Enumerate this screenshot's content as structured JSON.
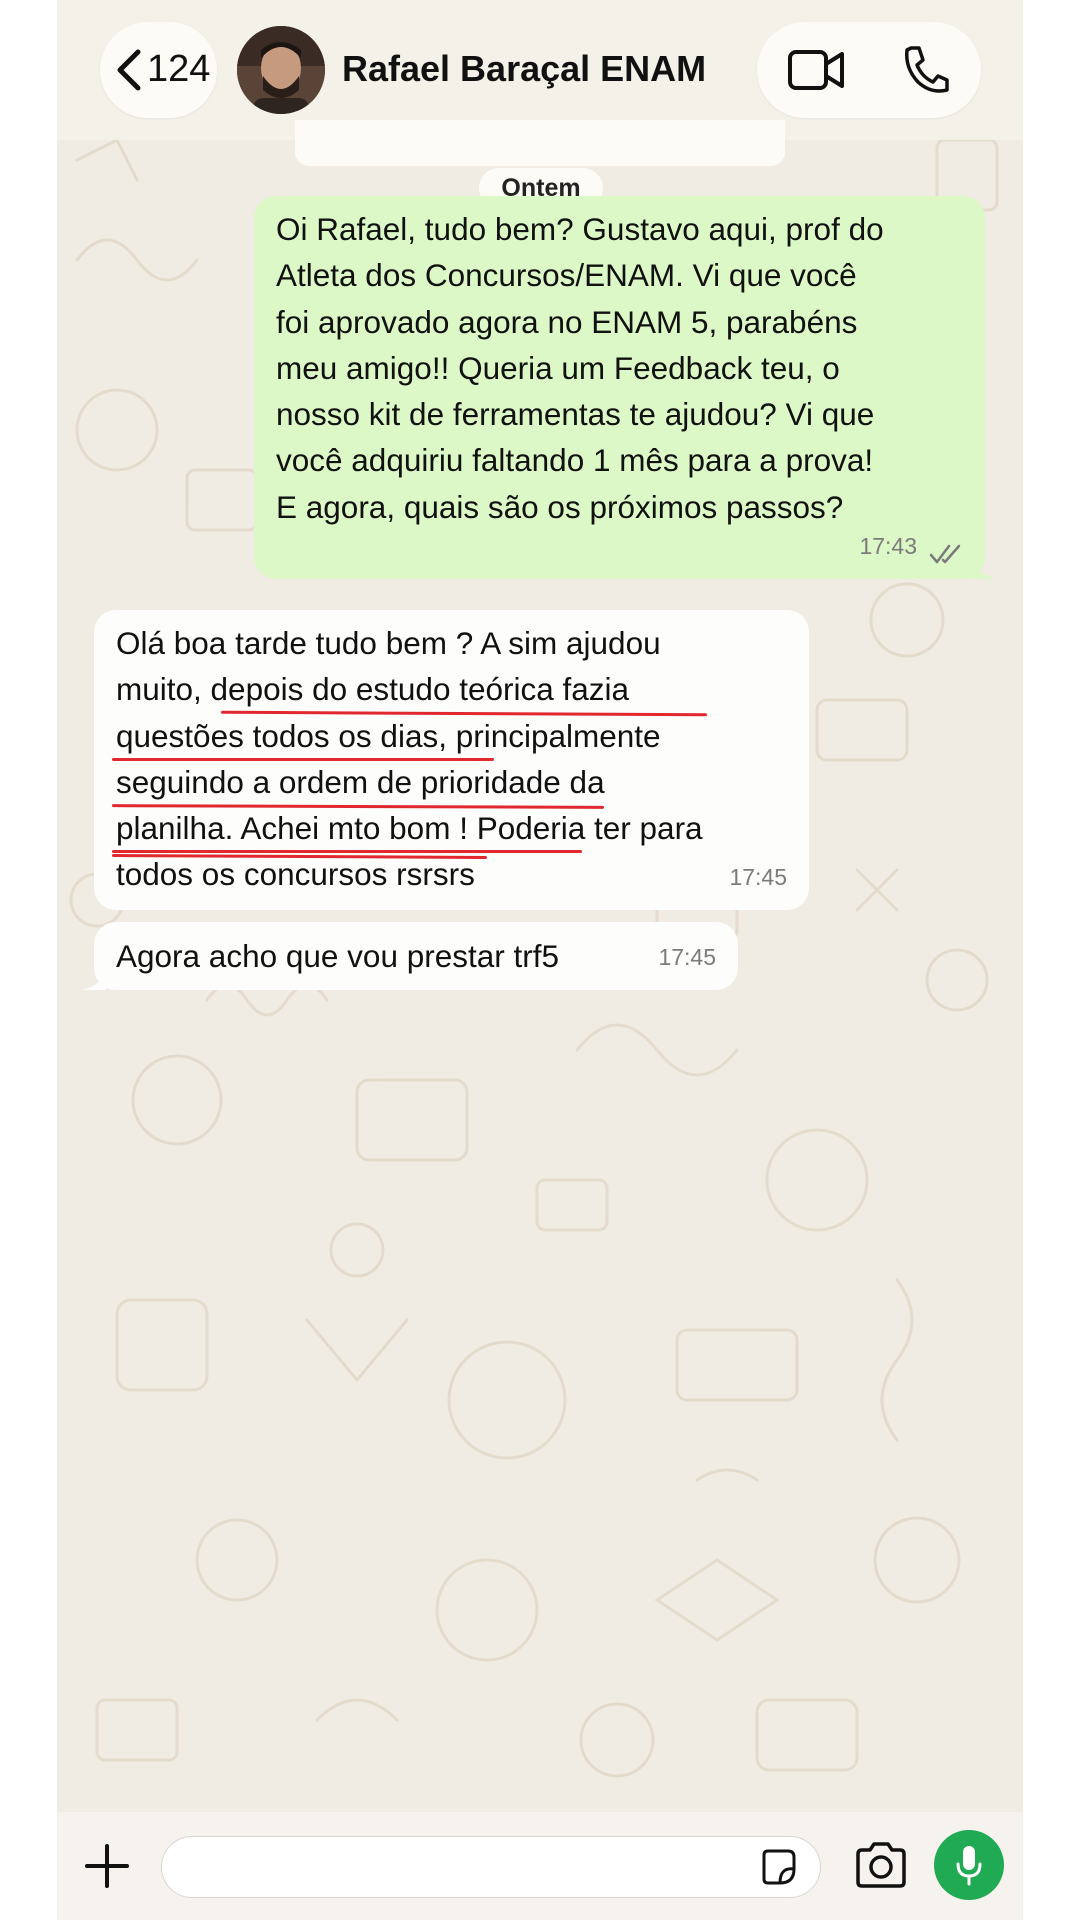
{
  "header": {
    "back_count": "124",
    "contact_name": "Rafael Baraçal ENAM"
  },
  "chat": {
    "date_divider": "Ontem",
    "messages": [
      {
        "direction": "outgoing",
        "lines": [
          "Oi Rafael, tudo bem? Gustavo aqui, prof do",
          "Atleta dos Concursos/ENAM. Vi que você",
          "foi aprovado agora no ENAM 5, parabéns",
          "meu amigo!! Queria um Feedback teu, o",
          "nosso kit de ferramentas te ajudou? Vi que",
          "você adquiriu faltando 1 mês para a prova!",
          "E agora, quais são os próximos passos?"
        ],
        "time": "17:43",
        "status": "read"
      },
      {
        "direction": "incoming",
        "lines": [
          "Olá boa tarde tudo bem ? A sim ajudou",
          "muito, depois do estudo teórica fazia",
          "questões todos os dias, principalmente",
          "seguindo a ordem de prioridade da",
          "planilha. Achei mto bom ! Poderia ter para",
          "todos os concursos rsrsrs"
        ],
        "time": "17:45"
      },
      {
        "direction": "incoming",
        "lines": [
          "Agora acho que vou prestar trf5"
        ],
        "time": "17:45"
      }
    ]
  },
  "composer": {
    "placeholder": ""
  },
  "colors": {
    "outgoing_bubble": "#dcf8c6",
    "incoming_bubble": "#fdfdfc",
    "chat_background": "#f1ece3",
    "mic_button": "#1faa53",
    "underline_annotation": "#e0282e"
  },
  "icons": [
    "chevron-left-icon",
    "video-call-icon",
    "phone-icon",
    "plus-icon",
    "sticker-icon",
    "camera-icon",
    "microphone-icon",
    "double-check-icon"
  ]
}
